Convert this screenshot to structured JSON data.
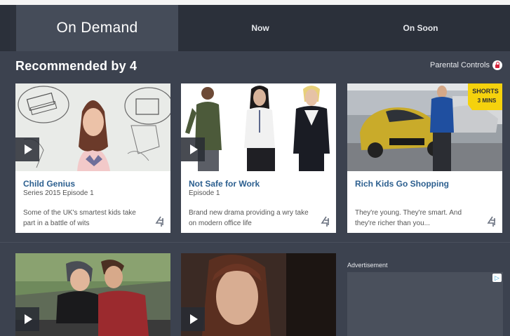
{
  "tabs": {
    "active": "On Demand",
    "now": "Now",
    "on_soon": "On Soon"
  },
  "section": {
    "title": "Recommended by 4",
    "parental_controls": "Parental Controls"
  },
  "cards": [
    {
      "title": "Child Genius",
      "subtitle": "Series 2015 Episode 1",
      "description": "Some of the UK's smartest kids take part in a battle of wits"
    },
    {
      "title": "Not Safe for Work",
      "subtitle": "Episode 1",
      "description": "Brand new drama providing a wry take on modern office life"
    },
    {
      "title": "Rich Kids Go Shopping",
      "subtitle": "",
      "description": "They're young. They're smart. And they're richer than you...",
      "badge_line1": "SHORTS",
      "badge_line2": "3 MINS"
    }
  ],
  "advertisement": {
    "label": "Advertisement",
    "info_icon": "ad-choices-icon"
  },
  "colors": {
    "background": "#3c424f",
    "tab_bar": "#2b303a",
    "active_tab": "#454c59",
    "title_link": "#2c5f8f",
    "badge": "#f5d20d"
  }
}
